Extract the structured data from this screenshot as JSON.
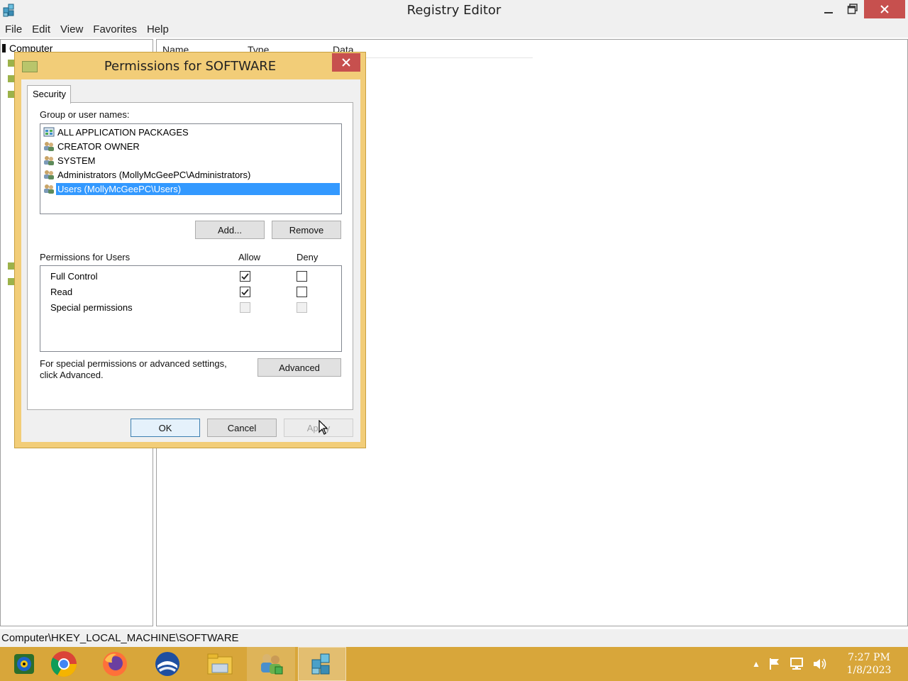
{
  "window": {
    "title": "Registry Editor",
    "menu": [
      "File",
      "Edit",
      "View",
      "Favorites",
      "Help"
    ]
  },
  "tree": {
    "root": "Computer"
  },
  "list": {
    "columns": [
      "Name",
      "Type",
      "Data"
    ]
  },
  "statusbar": {
    "path": "Computer\\HKEY_LOCAL_MACHINE\\SOFTWARE"
  },
  "dialog": {
    "title": "Permissions for SOFTWARE",
    "tab": "Security",
    "group_label": "Group or user names:",
    "users": [
      {
        "name": "ALL APPLICATION PACKAGES",
        "icon": "app-packages-icon",
        "selected": false
      },
      {
        "name": "CREATOR OWNER",
        "icon": "user-group-icon",
        "selected": false
      },
      {
        "name": "SYSTEM",
        "icon": "user-group-icon",
        "selected": false
      },
      {
        "name": "Administrators (MollyMcGeePC\\Administrators)",
        "icon": "user-group-icon",
        "selected": false
      },
      {
        "name": "Users (MollyMcGeePC\\Users)",
        "icon": "user-group-icon",
        "selected": true
      }
    ],
    "add_label": "Add...",
    "remove_label": "Remove",
    "permissions_for": "Permissions for Users",
    "allow_label": "Allow",
    "deny_label": "Deny",
    "permissions": [
      {
        "name": "Full Control",
        "allow": true,
        "deny": false,
        "enabled": true
      },
      {
        "name": "Read",
        "allow": true,
        "deny": false,
        "enabled": true
      },
      {
        "name": "Special permissions",
        "allow": false,
        "deny": false,
        "enabled": false
      }
    ],
    "advanced_note_line1": "For special permissions or advanced settings,",
    "advanced_note_line2": "click Advanced.",
    "advanced_label": "Advanced",
    "ok_label": "OK",
    "cancel_label": "Cancel",
    "apply_label": "Apply"
  },
  "taskbar": {
    "apps": [
      "media-center-icon",
      "chrome-icon",
      "firefox-icon",
      "opera-icon",
      "file-explorer-icon",
      "user-accounts-icon",
      "registry-editor-icon"
    ],
    "active_app": "registry-editor-icon",
    "clock_time": "7:27 PM",
    "clock_date": "1/8/2023"
  },
  "colors": {
    "taskbar": "#d8a63a",
    "dialog_frame": "#f2cd78",
    "selection": "#3399ff",
    "close_button": "#c7504e"
  }
}
